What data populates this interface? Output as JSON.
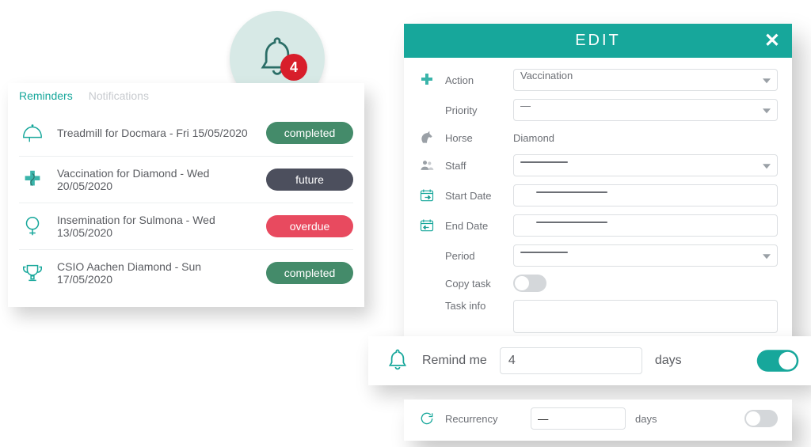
{
  "colors": {
    "teal": "#17a79b",
    "red": "#d81e2b",
    "green": "#448b6a",
    "dark": "#4c4f5d",
    "coral": "#e84a5f"
  },
  "bell": {
    "count": "4"
  },
  "tabs": {
    "reminders": "Reminders",
    "notifications": "Notifications"
  },
  "reminders": [
    {
      "icon": "helmet-icon",
      "text": "Treadmill for Docmara - Fri 15/05/2020",
      "status": "completed",
      "pill": "pill-completed"
    },
    {
      "icon": "medical-icon",
      "text": "Vaccination for Diamond  - Wed 20/05/2020",
      "status": "future",
      "pill": "pill-future"
    },
    {
      "icon": "fertility-icon",
      "text": "Insemination for Sulmona - Wed 13/05/2020",
      "status": "overdue",
      "pill": "pill-overdue"
    },
    {
      "icon": "trophy-icon",
      "text": "CSIO Aachen Diamond - Sun 17/05/2020",
      "status": "completed",
      "pill": "pill-completed"
    }
  ],
  "edit": {
    "title": "EDIT",
    "labels": {
      "action": "Action",
      "priority": "Priority",
      "horse": "Horse",
      "staff": "Staff",
      "startdate": "Start Date",
      "enddate": "End Date",
      "period": "Period",
      "copytask": "Copy task",
      "taskinfo": "Task info",
      "remindme": "Remind me",
      "recurrency": "Recurrency",
      "days": "days"
    },
    "values": {
      "action": "Vaccination",
      "priority": "—",
      "horse": "Diamond",
      "staff": "",
      "startdate": "",
      "enddate": "",
      "period": "",
      "copytask_on": false,
      "taskinfo": "",
      "remindme": "4",
      "remindme_on": true,
      "recurrency": "—",
      "recurrency_on": false
    }
  }
}
